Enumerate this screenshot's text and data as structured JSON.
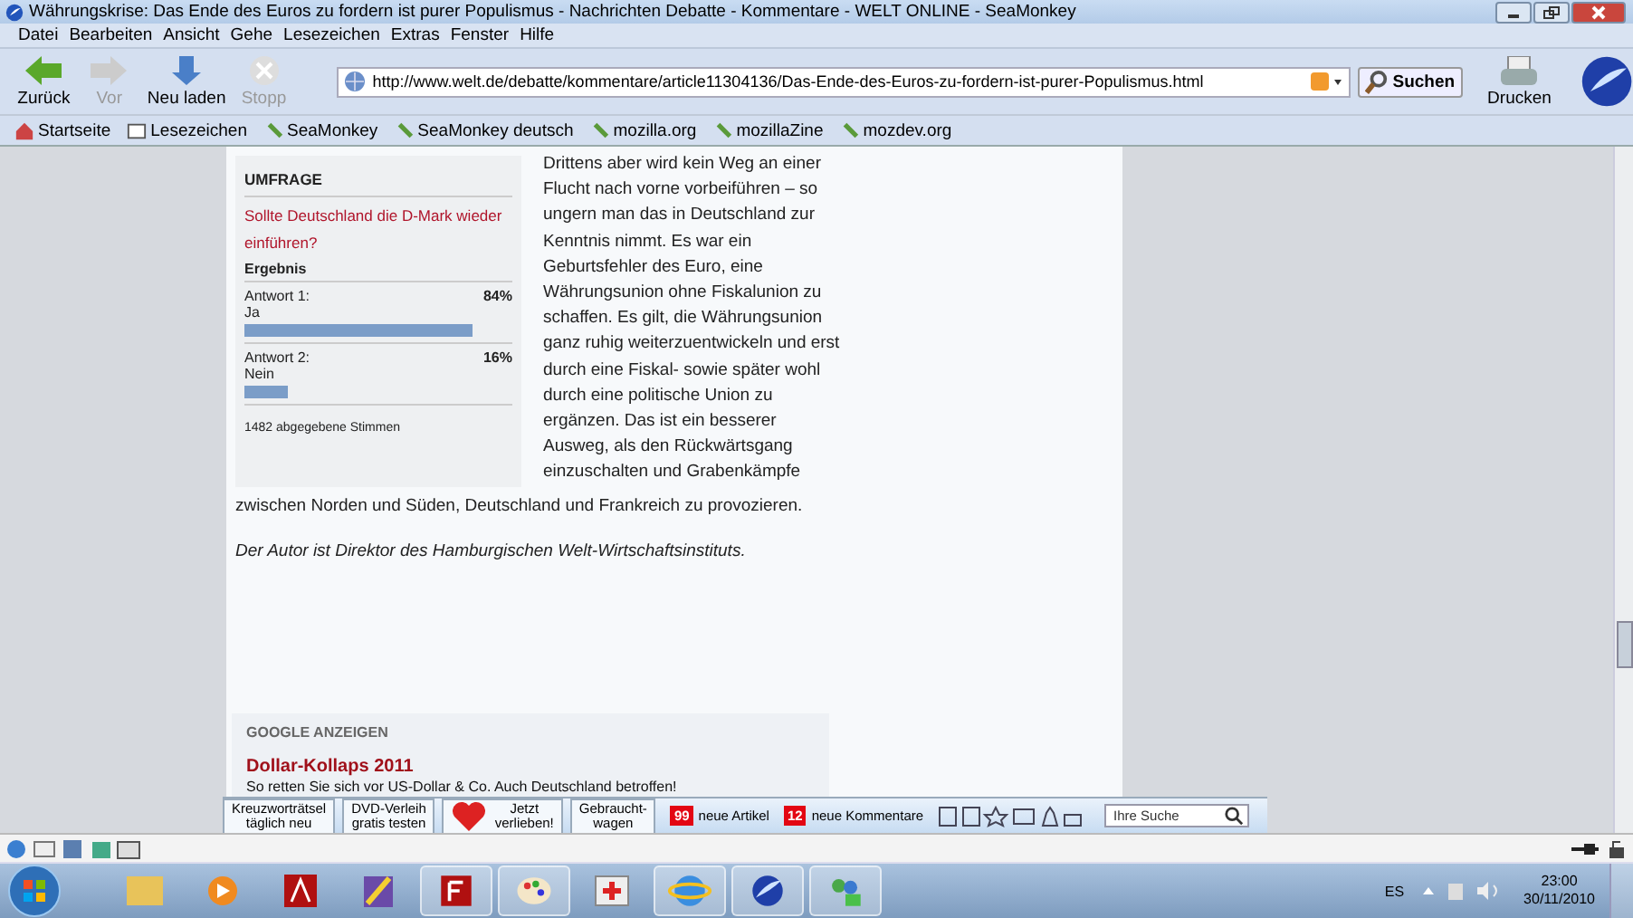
{
  "window": {
    "title": "Währungskrise: Das Ende des Euros zu fordern ist purer Populismus - Nachrichten Debatte - Kommentare - WELT ONLINE - SeaMonkey"
  },
  "menu": [
    "Datei",
    "Bearbeiten",
    "Ansicht",
    "Gehe",
    "Lesezeichen",
    "Extras",
    "Fenster",
    "Hilfe"
  ],
  "nav_buttons": [
    {
      "label": "Zurück",
      "kind": "back",
      "disabled": false
    },
    {
      "label": "Vor",
      "kind": "forward",
      "disabled": true
    },
    {
      "label": "Neu laden",
      "kind": "reload",
      "disabled": false
    },
    {
      "label": "Stopp",
      "kind": "stop",
      "disabled": true
    }
  ],
  "url": "http://www.welt.de/debatte/kommentare/article11304136/Das-Ende-des-Euros-zu-fordern-ist-purer-Populismus.html",
  "search_button": "Suchen",
  "print_button": "Drucken",
  "bookmarks": [
    {
      "label": "Startseite",
      "kind": "home"
    },
    {
      "label": "Lesezeichen",
      "kind": "folder"
    },
    {
      "label": "SeaMonkey",
      "kind": "link"
    },
    {
      "label": "SeaMonkey deutsch",
      "kind": "link"
    },
    {
      "label": "mozilla.org",
      "kind": "link"
    },
    {
      "label": "mozillaZine",
      "kind": "link"
    },
    {
      "label": "mozdev.org",
      "kind": "link"
    }
  ],
  "poll": {
    "heading": "UMFRAGE",
    "question": "Sollte Deutschland die D-Mark wieder einführen?",
    "result_label": "Ergebnis",
    "answers": [
      {
        "label": "Antwort 1:",
        "answer": "Ja",
        "percent": "84%",
        "level": 0.84
      },
      {
        "label": "Antwort 2:",
        "answer": "Nein",
        "percent": "16%",
        "level": 0.16
      }
    ],
    "votes": "1482 abgegebene Stimmen"
  },
  "article": {
    "paragraph": "Drittens aber wird kein Weg an einer Flucht nach vorne vorbeiführen – so ungern man das in Deutschland zur Kenntnis nimmt. Es war ein Geburtsfehler des Euro, eine Währungsunion ohne Fiskalunion zu schaffen. Es gilt, die Währungsunion ganz ruhig weiterzuentwickeln und erst durch eine Fiskal- sowie später wohl durch eine politische Union zu ergänzen. Das ist ein besserer Ausweg, als den Rückwärtsgang einzuschalten und Grabenkämpfe",
    "paragraph_end": "zwischen Norden und Süden, Deutschland und Frankreich zu provozieren.",
    "author_note": "Der Autor ist Direktor des Hamburgischen Welt-Wirtschaftsinstituts."
  },
  "ads": {
    "heading": "GOOGLE ANZEIGEN",
    "title": "Dollar-Kollaps 2011",
    "text": "So retten Sie sich vor US-Dollar & Co. Auch Deutschland betroffen!"
  },
  "welt_bar": {
    "buttons": [
      {
        "lines": [
          "Kreuzworträtsel",
          "täglich neu"
        ],
        "kind": "text"
      },
      {
        "lines": [
          "DVD-Verleih",
          "gratis testen"
        ],
        "kind": "text"
      },
      {
        "lines": [
          "Jetzt",
          "verlieben!"
        ],
        "kind": "heart"
      },
      {
        "lines": [
          "Gebraucht-",
          "wagen"
        ],
        "kind": "text"
      }
    ],
    "counters": [
      {
        "count": "99",
        "label": "neue Artikel"
      },
      {
        "count": "12",
        "label": "neue Kommentare"
      }
    ],
    "search_placeholder": "Ihre Suche"
  },
  "taskbar": {
    "language": "ES",
    "time": "23:00",
    "date": "30/11/2010"
  }
}
